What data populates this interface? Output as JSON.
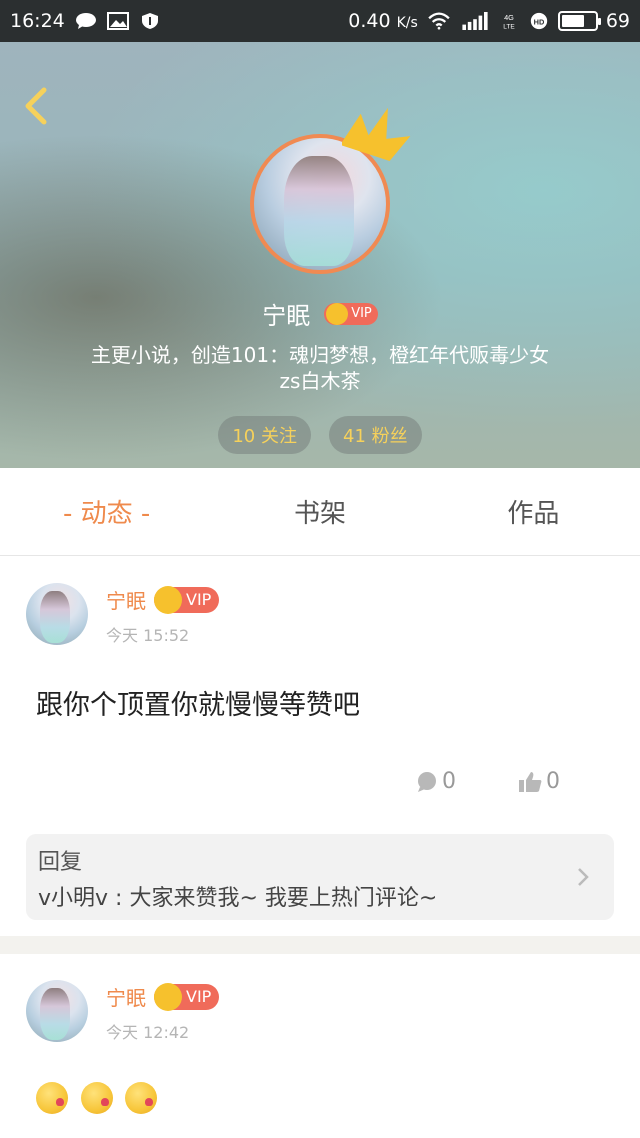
{
  "status_bar": {
    "time": "16:24",
    "speed": "0.40",
    "speed_unit": "K/s",
    "network": "4G LTE",
    "battery": "69",
    "battery_level": 0.69
  },
  "profile": {
    "name": "宁眠",
    "vip": "VIP",
    "bio_line1": "主更小说，创造101：魂归梦想，橙红年代贩毒少女",
    "bio_line2": "zs白木茶",
    "following": "10 关注",
    "followers": "41 粉丝"
  },
  "tabs": [
    {
      "label": "- 动态 -",
      "active": true
    },
    {
      "label": "书架",
      "active": false
    },
    {
      "label": "作品",
      "active": false
    }
  ],
  "posts": [
    {
      "name": "宁眠",
      "vip": "VIP",
      "time": "今天 15:52",
      "text": "跟你个顶置你就慢慢等赞吧",
      "comments": "0",
      "likes": "0",
      "reply": {
        "title": "回复",
        "text": "v小明v : 大家来赞我~ 我要上热门评论~"
      }
    },
    {
      "name": "宁眠",
      "vip": "VIP",
      "time": "今天 12:42",
      "emojis": [
        "kiss-emoji",
        "kiss-emoji",
        "kiss-emoji"
      ]
    }
  ],
  "colors": {
    "accent": "#ef8a4c",
    "vip_red": "#f06b5a",
    "stat_text": "#f6d15b"
  }
}
